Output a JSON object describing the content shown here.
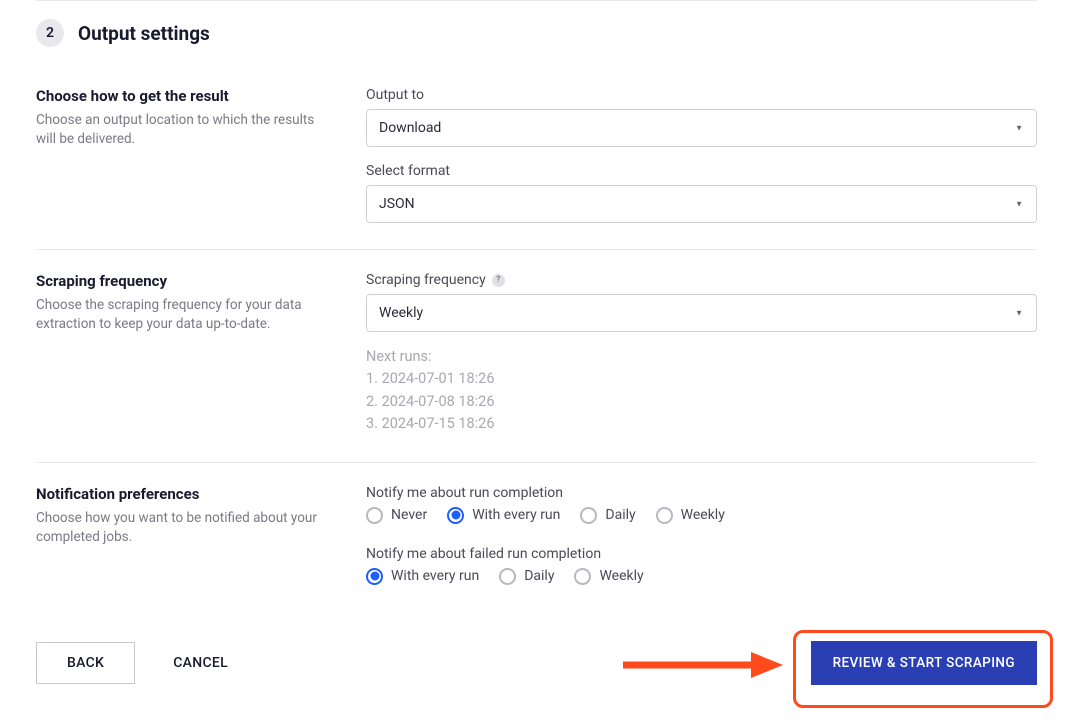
{
  "step": {
    "number": "2",
    "title": "Output settings"
  },
  "outputSection": {
    "heading": "Choose how to get the result",
    "description": "Choose an output location to which the results will be delivered.",
    "outputToLabel": "Output to",
    "outputToValue": "Download",
    "selectFormatLabel": "Select format",
    "selectFormatValue": "JSON"
  },
  "frequencySection": {
    "heading": "Scraping frequency",
    "description": "Choose the scraping frequency for your data extraction to keep your data up-to-date.",
    "freqLabel": "Scraping frequency",
    "freqValue": "Weekly",
    "nextRunsLabel": "Next runs:",
    "nextRuns": [
      "1. 2024-07-01 18:26",
      "2. 2024-07-08 18:26",
      "3. 2024-07-15 18:26"
    ]
  },
  "notificationSection": {
    "heading": "Notification preferences",
    "description": "Choose how you want to be notified about your completed jobs.",
    "completionLabel": "Notify me about run completion",
    "completionOptions": [
      {
        "label": "Never",
        "selected": false
      },
      {
        "label": "With every run",
        "selected": true
      },
      {
        "label": "Daily",
        "selected": false
      },
      {
        "label": "Weekly",
        "selected": false
      }
    ],
    "failedLabel": "Notify me about failed run completion",
    "failedOptions": [
      {
        "label": "With every run",
        "selected": true
      },
      {
        "label": "Daily",
        "selected": false
      },
      {
        "label": "Weekly",
        "selected": false
      }
    ]
  },
  "footer": {
    "back": "BACK",
    "cancel": "CANCEL",
    "review": "REVIEW & START SCRAPING"
  }
}
